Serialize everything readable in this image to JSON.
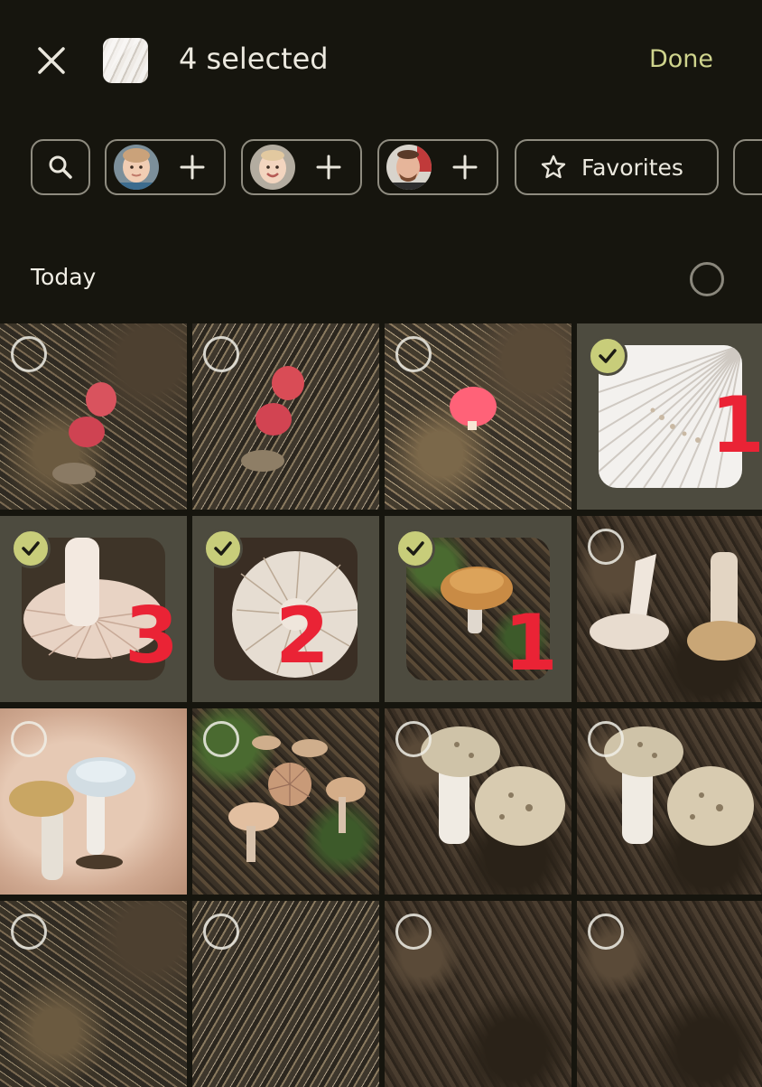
{
  "header": {
    "selected_text": "4 selected",
    "done_label": "Done"
  },
  "filters": {
    "favorites_label": "Favorites"
  },
  "section": {
    "title": "Today"
  },
  "colors": {
    "background": "#16150e",
    "accent": "#cfd48d",
    "check": "#c8cd7a",
    "annotation": "#ea2335"
  },
  "photos": [
    {
      "selected": false
    },
    {
      "selected": false
    },
    {
      "selected": false
    },
    {
      "selected": true,
      "annotation": "1"
    },
    {
      "selected": true,
      "annotation": "3"
    },
    {
      "selected": true,
      "annotation": "2"
    },
    {
      "selected": true,
      "annotation": "1"
    },
    {
      "selected": false
    },
    {
      "selected": false
    },
    {
      "selected": false
    },
    {
      "selected": false
    },
    {
      "selected": false
    }
  ]
}
